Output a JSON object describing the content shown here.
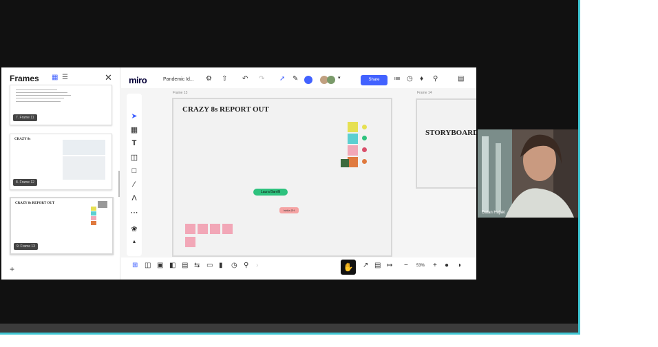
{
  "frames_panel": {
    "title": "Frames",
    "add_label": "+",
    "thumbnails": [
      {
        "label": "7. Frame 11"
      },
      {
        "label": "8. Frame 12",
        "title": "CRAZY 8s"
      },
      {
        "label": "9. Frame 13",
        "title": "CRAZY 8s REPORT OUT"
      }
    ]
  },
  "toolbar": {
    "logo": "miro",
    "board_name": "Pandemic Id...",
    "share_label": "Share",
    "icons": [
      "upload-icon",
      "undo-icon",
      "redo-icon",
      "cursor-icon",
      "reaction-icon",
      "avatar-group",
      "filter-icon",
      "timer-icon",
      "bell-icon",
      "search-icon",
      "notes-icon"
    ]
  },
  "left_toolbar": {
    "tools": [
      "select-tool",
      "frame-tool",
      "text-tool",
      "sticky-tool",
      "shape-tool",
      "pen-tool",
      "comment-tool",
      "more-tools",
      "apps-tool",
      "expand-tool"
    ]
  },
  "canvas": {
    "frame13": {
      "label": "Frame 13",
      "title": "CRAZY 8s REPORT OUT"
    },
    "frame14": {
      "label": "Frame 14",
      "title": "STORYBOARD"
    },
    "cursors": {
      "laura": "Laura Barrilli",
      "ishita": "Ishita ZH"
    }
  },
  "bottom_toolbar": {
    "zoom": "53%",
    "zoom_out": "−",
    "zoom_in": "+"
  },
  "webcam": {
    "participant_name": "Dalan Hajaki"
  },
  "colors": {
    "accent": "#4262ff",
    "webcam_border": "#3fc6d3",
    "sticky_yellow": "#e6e052",
    "sticky_teal": "#5ccfd1",
    "sticky_pink": "#f2a7b7",
    "sticky_orange": "#e07a3f",
    "cursor_green": "#2ec27e"
  }
}
